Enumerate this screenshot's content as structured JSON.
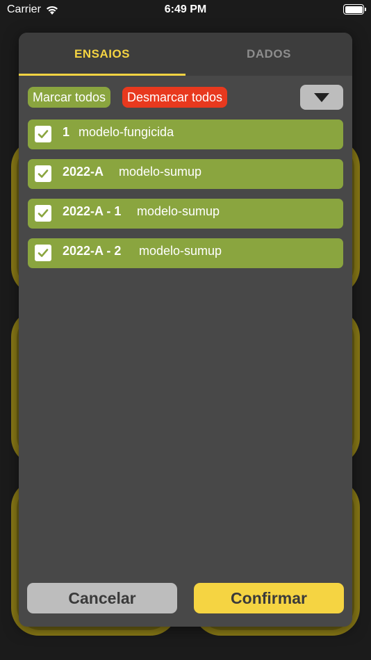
{
  "status_bar": {
    "carrier": "Carrier",
    "time": "6:49 PM"
  },
  "tabs": [
    {
      "label": "ENSAIOS",
      "active": true
    },
    {
      "label": "DADOS",
      "active": false
    }
  ],
  "toolbar": {
    "mark_all": "Marcar todos",
    "unmark_all": "Desmarcar todos"
  },
  "items": [
    {
      "code": "1",
      "name": "modelo-fungicida",
      "checked": true
    },
    {
      "code": "2022-A",
      "name": "modelo-sumup",
      "checked": true
    },
    {
      "code": "2022-A - 1",
      "name": "modelo-sumup",
      "checked": true
    },
    {
      "code": "2022-A - 2",
      "name": "modelo-sumup",
      "checked": true
    }
  ],
  "footer": {
    "cancel": "Cancelar",
    "confirm": "Confirmar"
  },
  "colors": {
    "accent_yellow": "#f5d442",
    "item_green": "#8aa53f",
    "unmark_red": "#e8391e",
    "modal_bg": "#484848"
  }
}
